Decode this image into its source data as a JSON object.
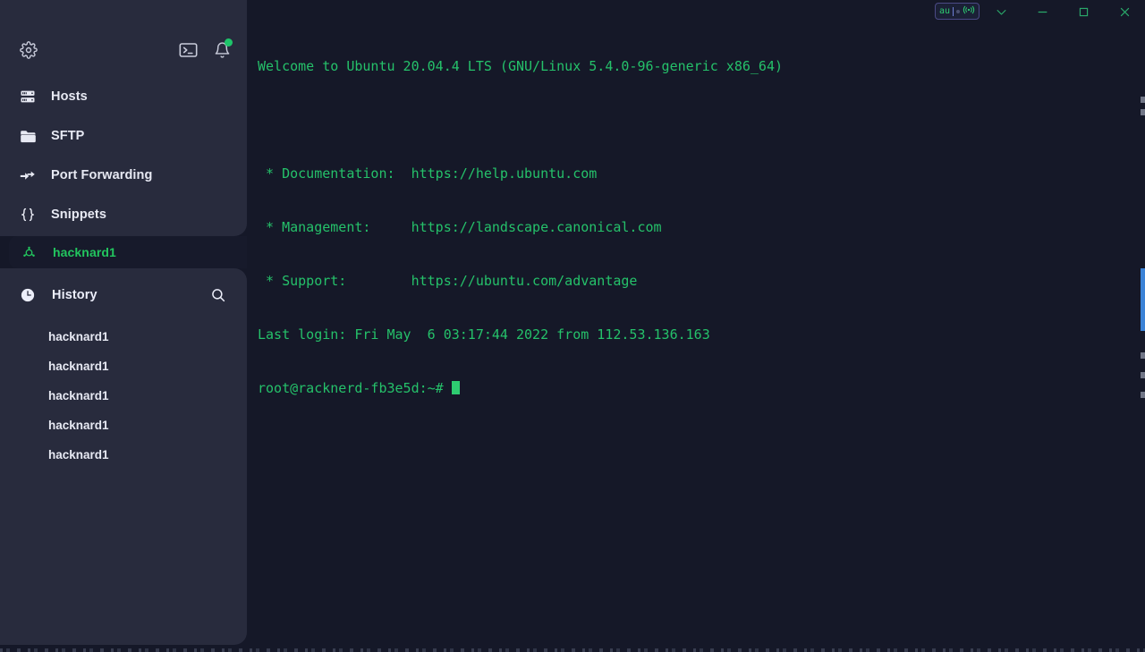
{
  "app": {
    "sidebar_bg": "#282b3d",
    "terminal_bg": "#151828",
    "accent_green": "#22c55e",
    "scroll_accent": "#3b82d6"
  },
  "sidebar": {
    "top_icons": [
      {
        "name": "settings-gear",
        "label": "Settings"
      },
      {
        "name": "terminal",
        "label": "New Terminal"
      },
      {
        "name": "notifications-bell",
        "label": "Notifications",
        "badge": true
      }
    ],
    "nav_items": [
      {
        "icon": "server-rack-icon",
        "label": "Hosts"
      },
      {
        "icon": "folder-icon",
        "label": "SFTP"
      },
      {
        "icon": "port-forwarding-icon",
        "label": "Port Forwarding"
      },
      {
        "icon": "braces-icon",
        "label": "Snippets"
      }
    ],
    "active_session": {
      "icon": "session-node-icon",
      "label": "hacknard1"
    },
    "history": {
      "icon": "clock-icon",
      "title": "History",
      "search_icon": "search-icon",
      "items": [
        {
          "label": "hacknard1"
        },
        {
          "label": "hacknard1"
        },
        {
          "label": "hacknard1"
        },
        {
          "label": "hacknard1"
        },
        {
          "label": "hacknard1"
        }
      ]
    }
  },
  "titlebar": {
    "recording_pill": {
      "text": "au",
      "icon": "broadcast-icon"
    },
    "controls": [
      {
        "name": "chevron-down-button",
        "glyph": "chevron-down"
      },
      {
        "name": "minimize-button",
        "glyph": "minimize"
      },
      {
        "name": "maximize-button",
        "glyph": "maximize"
      },
      {
        "name": "close-button",
        "glyph": "close"
      }
    ]
  },
  "terminal": {
    "lines": [
      "Welcome to Ubuntu 20.04.4 LTS (GNU/Linux 5.4.0-96-generic x86_64)",
      "",
      " * Documentation:  https://help.ubuntu.com",
      " * Management:     https://landscape.canonical.com",
      " * Support:        https://ubuntu.com/advantage",
      "Last login: Fri May  6 03:17:44 2022 from 112.53.136.163"
    ],
    "prompt": "root@racknerd-fb3e5d:~# "
  }
}
